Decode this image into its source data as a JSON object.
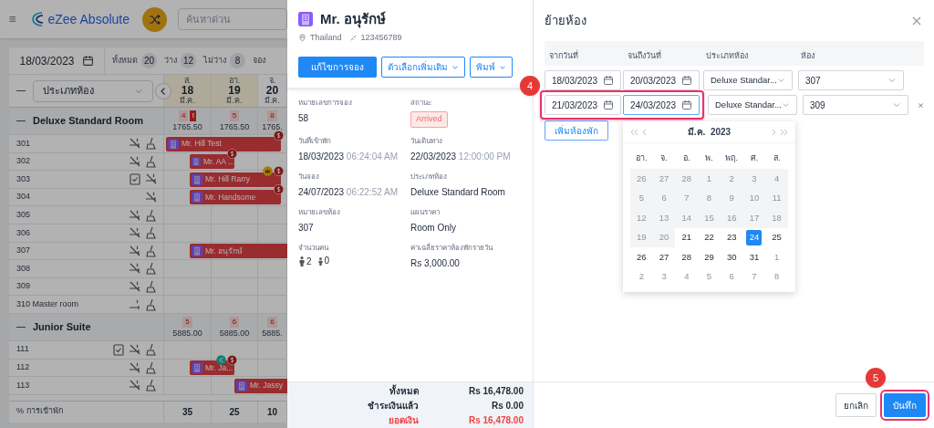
{
  "app": {
    "title": "eZee Absolute",
    "search_placeholder": "ค้นหาด่วน"
  },
  "date_bar": {
    "date": "18/03/2023",
    "stats": [
      {
        "label": "ทั้งหมด",
        "count": "20"
      },
      {
        "label": "ว่าง",
        "count": "12"
      },
      {
        "label": "ไม่ว่าง",
        "count": "8"
      },
      {
        "label": "จอง"
      }
    ]
  },
  "grid": {
    "room_type_filter": "ประเภทห้อง",
    "days": [
      {
        "weekday": "ส.",
        "date": "18",
        "month": "มี.ค.",
        "weekend": true
      },
      {
        "weekday": "อา.",
        "date": "19",
        "month": "มี.ค.",
        "weekend": true
      },
      {
        "weekday": "จ.",
        "date": "20",
        "month": "มี.ค.",
        "weekend": false
      }
    ],
    "groups": [
      {
        "name": "Deluxe Standard Room",
        "availability": [
          {
            "count": "4",
            "flag": "!",
            "price": "1765.50"
          },
          {
            "count": "5",
            "price": "1765.50"
          },
          {
            "count": "8",
            "price": "1765."
          }
        ],
        "rooms": [
          {
            "number": "301",
            "checklist": false,
            "smoking": false,
            "cleaning": true,
            "booking": {
              "guest": "Mr. Hill Test",
              "kind": "continuing",
              "paid": true,
              "vip": false,
              "shared": false
            }
          },
          {
            "number": "302",
            "checklist": false,
            "smoking": false,
            "cleaning": true,
            "booking": {
              "guest": "Mr. AA ...",
              "kind": "short",
              "paid": true,
              "vip": false,
              "shared": false
            }
          },
          {
            "number": "303",
            "checklist": true,
            "smoking": false,
            "cleaning": false,
            "booking": {
              "guest": "Mr. Hill Rarry",
              "kind": "long",
              "paid": true,
              "vip": true,
              "shared": false
            }
          },
          {
            "number": "304",
            "checklist": false,
            "smoking": false,
            "cleaning": false,
            "booking": {
              "guest": "Mr. Handsome",
              "kind": "long",
              "paid": true,
              "vip": false,
              "shared": false
            }
          },
          {
            "number": "305",
            "checklist": false,
            "smoking": false,
            "cleaning": true
          },
          {
            "number": "306",
            "checklist": false,
            "smoking": false,
            "cleaning": true
          },
          {
            "number": "307",
            "checklist": false,
            "smoking": false,
            "cleaning": true,
            "booking": {
              "guest": "Mr. อนุรักษ์",
              "kind": "open",
              "paid": false,
              "vip": false,
              "shared": false
            }
          },
          {
            "number": "308",
            "checklist": false,
            "smoking": false,
            "cleaning": true
          },
          {
            "number": "309",
            "checklist": false,
            "smoking": false,
            "cleaning": true
          },
          {
            "number": "310 Master room",
            "checklist": false,
            "smoking": true,
            "cleaning": true
          }
        ]
      },
      {
        "name": "Junior Suite",
        "availability": [
          {
            "count": "5",
            "price": "5885.00"
          },
          {
            "count": "6",
            "price": "5885.00"
          },
          {
            "count": "6",
            "price": "5885."
          }
        ],
        "rooms": [
          {
            "number": "111",
            "checklist": true,
            "smoking": false,
            "cleaning": true
          },
          {
            "number": "112",
            "checklist": false,
            "smoking": false,
            "cleaning": true,
            "booking": {
              "guest": "Mr. Ja...",
              "kind": "short",
              "paid": true,
              "vip": false,
              "shared": true
            }
          },
          {
            "number": "113",
            "checklist": false,
            "smoking": false,
            "cleaning": true,
            "booking": {
              "guest": "Mr. Jassy",
              "kind": "late",
              "paid": false,
              "vip": false,
              "shared": false
            }
          }
        ]
      }
    ],
    "occupancy": {
      "label": "% การเข้าพัก",
      "values": [
        "35",
        "25",
        "10"
      ]
    }
  },
  "booking_panel": {
    "guest": {
      "name": "Mr. อนุรักษ์",
      "country": "Thailand",
      "phone": "123456789"
    },
    "buttons": [
      {
        "label": "แก้ไขการจอง",
        "kind": "primary"
      },
      {
        "label": "ตัวเลือกเพิ่มเติม",
        "kind": "dropdown"
      },
      {
        "label": "พิมพ์",
        "kind": "dropdown"
      }
    ],
    "details": [
      {
        "label": "หมายเลขการจอง",
        "value": "58",
        "kind": "text"
      },
      {
        "label": "สถานะ",
        "value": "Arrived",
        "kind": "badge"
      },
      {
        "label": "วันที่เข้าพัก",
        "value": "18/03/2023",
        "time": "06:24:04 AM",
        "kind": "text"
      },
      {
        "label": "วันเดินทาง",
        "value": "22/03/2023",
        "time": "12:00:00 PM",
        "kind": "text"
      },
      {
        "label": "วันจอง",
        "value": "24/07/2023",
        "time": "06:22:52 AM",
        "kind": "text"
      },
      {
        "label": "ประเภทห้อง",
        "value": "Deluxe Standard Room",
        "kind": "text"
      },
      {
        "label": "หมายเลขห้อง",
        "value": "307",
        "kind": "text"
      },
      {
        "label": "แผนราคา",
        "value": "Room Only",
        "kind": "text"
      },
      {
        "label": "จำนวนคน",
        "adults": "2",
        "children": "0",
        "kind": "people"
      },
      {
        "label": "ค่าเฉลี่ยราคาห้องพักรายวัน",
        "value": "Rs 3,000.00",
        "kind": "text"
      }
    ],
    "totals": [
      {
        "label": "ทั้งหมด",
        "value": "Rs 16,478.00",
        "highlight": false
      },
      {
        "label": "ชำระเงินแล้ว",
        "value": "Rs 0.00",
        "highlight": false
      },
      {
        "label": "ยอดเงิน",
        "value": "Rs 16,478.00",
        "highlight": true
      }
    ]
  },
  "move_room": {
    "title": "ย้ายห้อง",
    "columns": [
      "จากวันที่",
      "จนถึงวันที่",
      "ประเภทห้อง",
      "ห้อง"
    ],
    "rows": [
      {
        "from": "18/03/2023",
        "to": "20/03/2023",
        "room_type": "Deluxe Standar...",
        "room": "307",
        "removable": false,
        "highlighted": false,
        "to_focused": false
      },
      {
        "from": "21/03/2023",
        "to": "24/03/2023",
        "room_type": "Deluxe Standar...",
        "room": "309",
        "removable": true,
        "highlighted": true,
        "to_focused": true,
        "step": "4"
      }
    ],
    "add_button": "เพิ่มห้องพัก",
    "calendar": {
      "month": "มี.ค.",
      "year": "2023",
      "weekdays": [
        "อา.",
        "จ.",
        "อ.",
        "พ.",
        "พฤ.",
        "ศ.",
        "ส."
      ],
      "weeks": [
        [
          {
            "day": "26",
            "kind": "disabled",
            "selected": false
          },
          {
            "day": "27",
            "kind": "disabled",
            "selected": false
          },
          {
            "day": "28",
            "kind": "disabled",
            "selected": false
          },
          {
            "day": "1",
            "kind": "disabled",
            "selected": false
          },
          {
            "day": "2",
            "kind": "disabled",
            "selected": false
          },
          {
            "day": "3",
            "kind": "disabled",
            "selected": false
          },
          {
            "day": "4",
            "kind": "disabled",
            "selected": false
          }
        ],
        [
          {
            "day": "5",
            "kind": "disabled",
            "selected": false
          },
          {
            "day": "6",
            "kind": "disabled",
            "selected": false
          },
          {
            "day": "7",
            "kind": "disabled",
            "selected": false
          },
          {
            "day": "8",
            "kind": "disabled",
            "selected": false
          },
          {
            "day": "9",
            "kind": "disabled",
            "selected": false
          },
          {
            "day": "10",
            "kind": "disabled",
            "selected": false
          },
          {
            "day": "11",
            "kind": "disabled",
            "selected": false
          }
        ],
        [
          {
            "day": "12",
            "kind": "disabled",
            "selected": false
          },
          {
            "day": "13",
            "kind": "disabled",
            "selected": false
          },
          {
            "day": "14",
            "kind": "disabled",
            "selected": false
          },
          {
            "day": "15",
            "kind": "disabled",
            "selected": false
          },
          {
            "day": "16",
            "kind": "disabled",
            "selected": false
          },
          {
            "day": "17",
            "kind": "disabled",
            "selected": false
          },
          {
            "day": "18",
            "kind": "disabled",
            "selected": false
          }
        ],
        [
          {
            "day": "19",
            "kind": "disabled",
            "selected": false
          },
          {
            "day": "20",
            "kind": "disabled",
            "selected": false
          },
          {
            "day": "21",
            "kind": "available",
            "selected": false
          },
          {
            "day": "22",
            "kind": "available",
            "selected": false
          },
          {
            "day": "23",
            "kind": "available",
            "selected": false
          },
          {
            "day": "24",
            "kind": "available",
            "selected": true
          },
          {
            "day": "25",
            "kind": "available",
            "selected": false
          }
        ],
        [
          {
            "day": "26",
            "kind": "available",
            "selected": false
          },
          {
            "day": "27",
            "kind": "available",
            "selected": false
          },
          {
            "day": "28",
            "kind": "available",
            "selected": false
          },
          {
            "day": "29",
            "kind": "available",
            "selected": false
          },
          {
            "day": "30",
            "kind": "available",
            "selected": false
          },
          {
            "day": "31",
            "kind": "available",
            "selected": false
          },
          {
            "day": "1",
            "kind": "outside",
            "selected": false
          }
        ],
        [
          {
            "day": "2",
            "kind": "outside",
            "selected": false
          },
          {
            "day": "3",
            "kind": "outside",
            "selected": false
          },
          {
            "day": "4",
            "kind": "outside",
            "selected": false
          },
          {
            "day": "5",
            "kind": "outside",
            "selected": false
          },
          {
            "day": "6",
            "kind": "outside",
            "selected": false
          },
          {
            "day": "7",
            "kind": "outside",
            "selected": false
          },
          {
            "day": "8",
            "kind": "outside",
            "selected": false
          }
        ]
      ]
    },
    "cancel_button": "ยกเลิก",
    "save_button": "บันทึก",
    "save_step": "5"
  }
}
